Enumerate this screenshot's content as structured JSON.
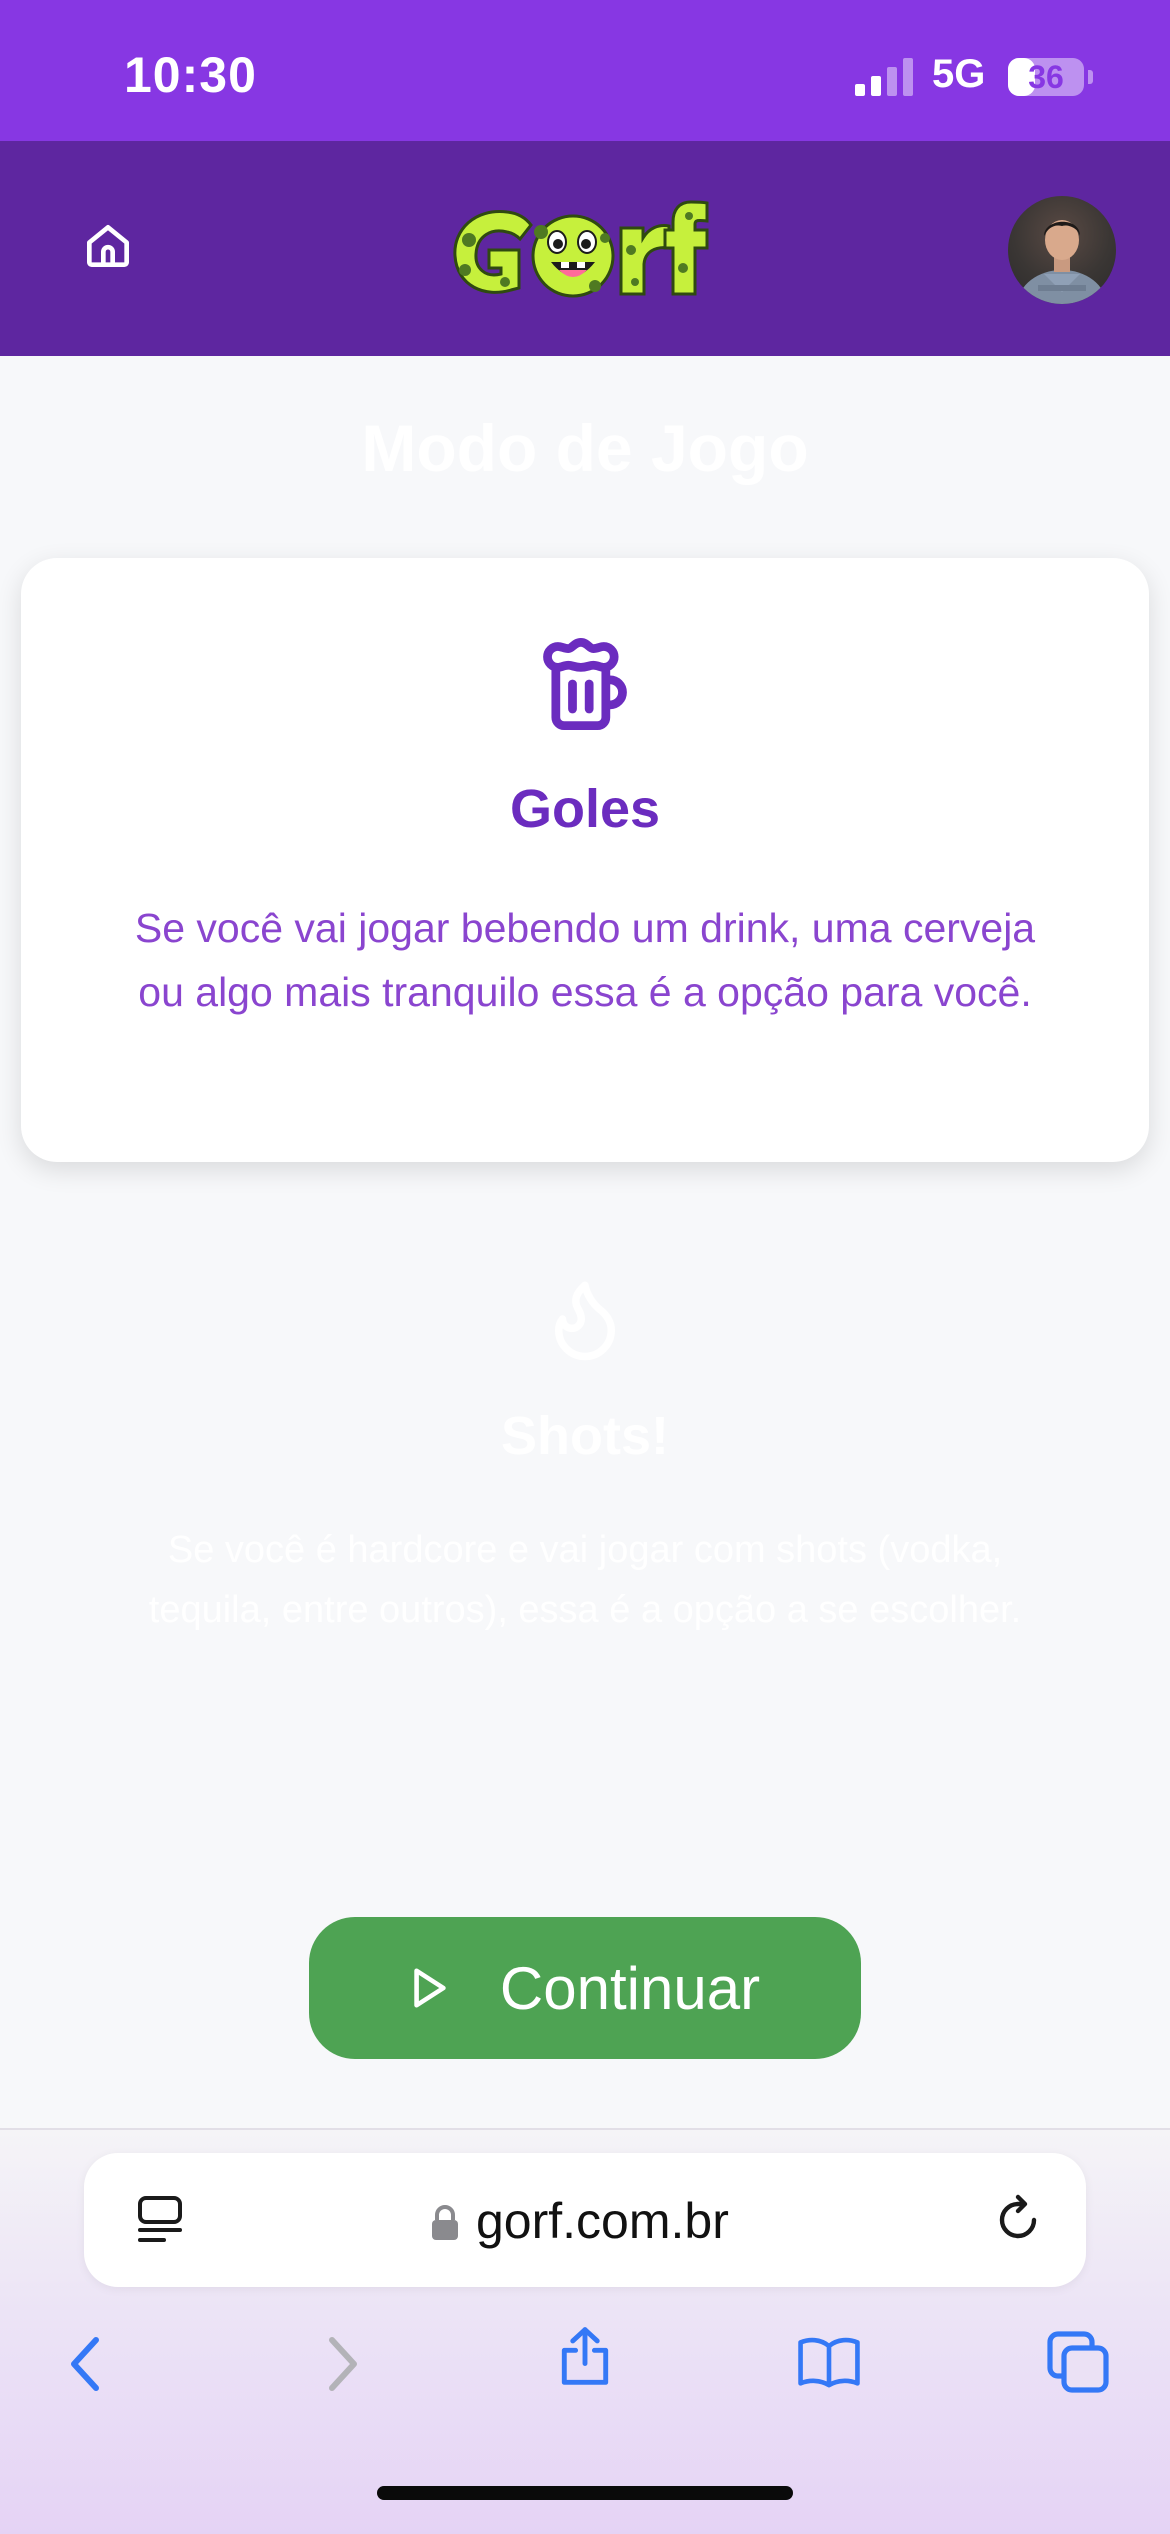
{
  "status_bar": {
    "time": "10:30",
    "network": "5G",
    "battery": "36",
    "battery_level": 0.36
  },
  "header": {
    "logo_text": "Gorf",
    "home_icon": "home-icon",
    "avatar": "user-avatar"
  },
  "page": {
    "title": "Modo de Jogo"
  },
  "options": [
    {
      "icon": "beer-mug-icon",
      "title": "Goles",
      "description": "Se você vai jogar bebendo um drink, uma cerveja ou algo mais tranquilo essa é a opção para você.",
      "selected": true
    },
    {
      "icon": "flame-icon",
      "title": "Shots!",
      "description": "Se você é hardcore e vai jogar com shots (vodka, tequila, entre outros), essa é a opção a se escolher.",
      "selected": false
    }
  ],
  "continue_button": {
    "label": "Continuar",
    "icon": "play-icon"
  },
  "browser": {
    "url": "gorf.com.br",
    "reader_icon": "reader-mode-icon",
    "lock_icon": "lock-icon",
    "reload_icon": "reload-icon",
    "toolbar": [
      "back-icon",
      "forward-icon",
      "share-icon",
      "bookmarks-icon",
      "tabs-icon"
    ]
  },
  "colors": {
    "status_bar": "#8737e3",
    "header": "#5e26a0",
    "accent_purple": "#6b2cbf",
    "continue_green": "#4ea353",
    "logo_green": "#c6f03c"
  }
}
